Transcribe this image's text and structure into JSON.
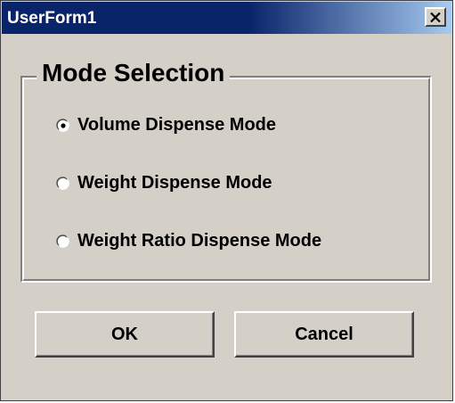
{
  "window": {
    "title": "UserForm1",
    "close_icon": "close-icon"
  },
  "frame": {
    "legend": "Mode Selection",
    "options": [
      {
        "label": "Volume Dispense Mode",
        "selected": true
      },
      {
        "label": "Weight Dispense Mode",
        "selected": false
      },
      {
        "label": "Weight Ratio Dispense Mode",
        "selected": false
      }
    ]
  },
  "buttons": {
    "ok_label": "OK",
    "cancel_label": "Cancel"
  },
  "colors": {
    "face": "#d4d0c8",
    "titlebar_start": "#0a246a",
    "titlebar_end": "#a6caf0"
  }
}
